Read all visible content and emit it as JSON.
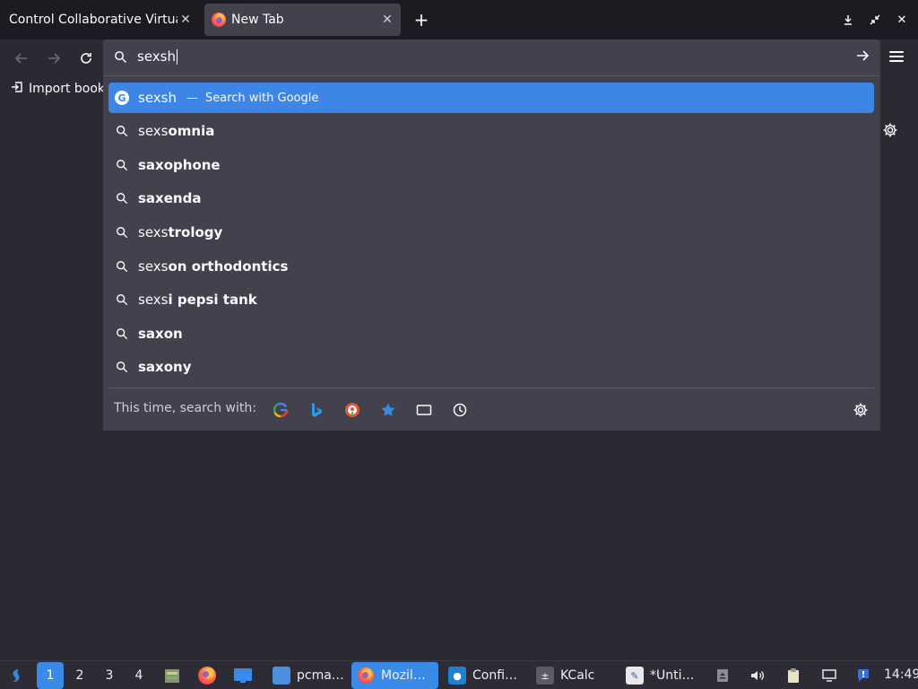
{
  "tabs": [
    {
      "title": "Control Collaborative Virtual"
    },
    {
      "title": "New Tab"
    }
  ],
  "urlbar": {
    "value": "sexsh"
  },
  "bookmarks": {
    "import_label": "Import book"
  },
  "suggestions": {
    "first": {
      "typed": "sexsh",
      "separator": "—",
      "action": "Search with Google"
    },
    "items": [
      {
        "prefix": "sexs",
        "bold": "omnia"
      },
      {
        "prefix": "",
        "bold": "saxophone"
      },
      {
        "prefix": "",
        "bold": "saxenda"
      },
      {
        "prefix": "sexs",
        "bold": "trology"
      },
      {
        "prefix": "sexs",
        "bold": "on orthodontics"
      },
      {
        "prefix": "sexs",
        "bold": "i pepsi tank"
      },
      {
        "prefix": "",
        "bold": "saxon"
      },
      {
        "prefix": "",
        "bold": "saxony"
      }
    ]
  },
  "oneoff": {
    "label": "This time, search with:",
    "engines": [
      "google-icon",
      "bing-icon",
      "duckduckgo-icon",
      "bookmarks-icon",
      "tabs-icon",
      "history-icon"
    ]
  },
  "taskbar": {
    "workspaces": [
      "1",
      "2",
      "3",
      "4"
    ],
    "tasks": [
      {
        "label": "pcma…",
        "icon": "folder-icon"
      },
      {
        "label": "Mozil…",
        "icon": "firefox-icon"
      },
      {
        "label": "Confi…",
        "icon": "settings-icon"
      },
      {
        "label": "KCalc",
        "icon": "calculator-icon"
      },
      {
        "label": "*Unti…",
        "icon": "text-editor-icon"
      }
    ],
    "clock": "14:49"
  },
  "colors": {
    "accent": "#3a8be8",
    "selected_row": "#3d86e6",
    "toolbar": "#2b2a33",
    "popup": "#42414d",
    "tabstrip": "#1c1b22"
  }
}
